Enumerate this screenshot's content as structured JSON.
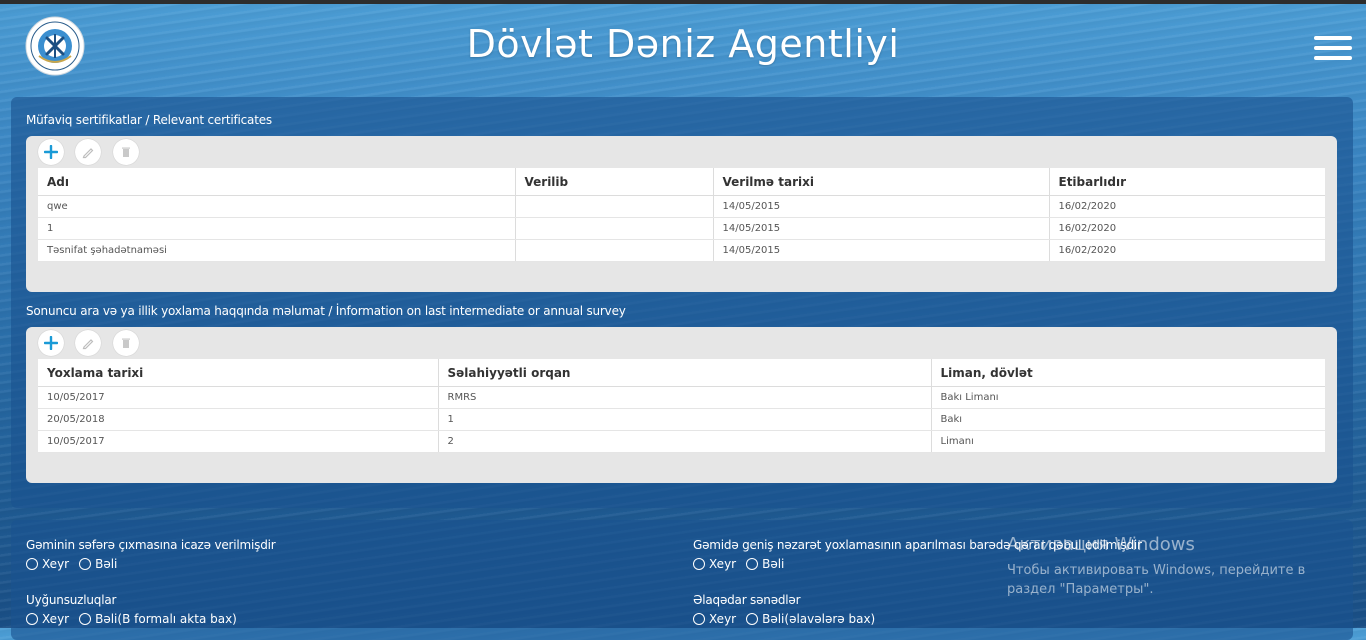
{
  "header": {
    "title": "Dövlət Dəniz Agentliyi",
    "logo_icon": "anchor-emblem-logo",
    "menu_icon": "hamburger-menu-icon"
  },
  "certificates": {
    "title": "Müfaviq sertifikatlar / Relevant certificates",
    "toolbar": {
      "add": "+",
      "edit_icon": "pencil-icon",
      "delete_icon": "trash-icon"
    },
    "columns": [
      "Adı",
      "Verilib",
      "Verilmə tarixi",
      "Etibarlıdır"
    ],
    "rows": [
      [
        "qwe",
        "",
        "14/05/2015",
        "16/02/2020"
      ],
      [
        "1",
        "",
        "14/05/2015",
        "16/02/2020"
      ],
      [
        "Təsnifat şəhadətnaməsi",
        "",
        "14/05/2015",
        "16/02/2020"
      ]
    ]
  },
  "survey": {
    "title": "Sonuncu ara və ya illik yoxlama haqqında məlumat / İnformation on last intermediate or annual survey",
    "columns": [
      "Yoxlama tarixi",
      "Səlahiyyətli orqan",
      "Liman, dövlət"
    ],
    "rows": [
      [
        "10/05/2017",
        "RMRS",
        "Bakı Limanı"
      ],
      [
        "20/05/2018",
        "1",
        "Bakı"
      ],
      [
        "10/05/2017",
        "2",
        "Limanı"
      ]
    ]
  },
  "questions": {
    "q1": {
      "label": "Gəminin səfərə çıxmasına icazə verilmişdir",
      "opt_no": "Xeyr",
      "opt_yes": "Bəli"
    },
    "q2": {
      "label": "Gəmidə geniş nəzarət yoxlamasının aparılması barədə qərar qəbul edilmişdir",
      "opt_no": "Xeyr",
      "opt_yes": "Bəli"
    },
    "q3": {
      "label": "Uyğunsuzluqlar",
      "opt_no": "Xeyr",
      "opt_yes": "Bəli(B formalı akta bax)"
    },
    "q4": {
      "label": "Əlaqədar sənədlər",
      "opt_no": "Xeyr",
      "opt_yes": "Bəli(əlavələrə bax)"
    }
  },
  "watermark": {
    "line1": "Активация Windows",
    "line2": "Чтобы активировать Windows, перейдите в",
    "line3": "раздел \"Параметры\"."
  }
}
